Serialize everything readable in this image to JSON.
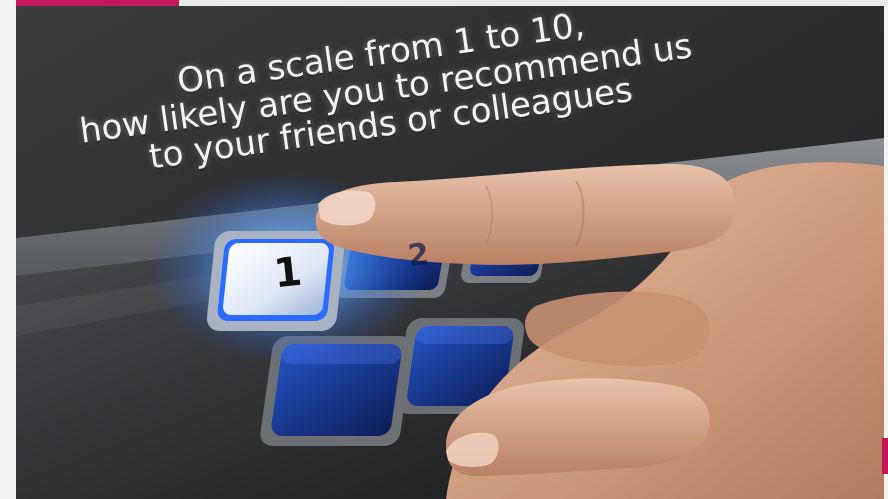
{
  "headline": {
    "line1": "On a scale from 1 to 10,",
    "line2": "how likely are you to recommend us",
    "line3": "to your friends or colleagues"
  },
  "keypad": {
    "highlighted_key": "1",
    "key2_hint": "2"
  },
  "colors": {
    "accent": "#c2185b",
    "screen_dark": "#2e2f31",
    "key_blue": "#1d3f9a",
    "key_glow": "#6fb4ff",
    "skin": "#d9a88a"
  }
}
